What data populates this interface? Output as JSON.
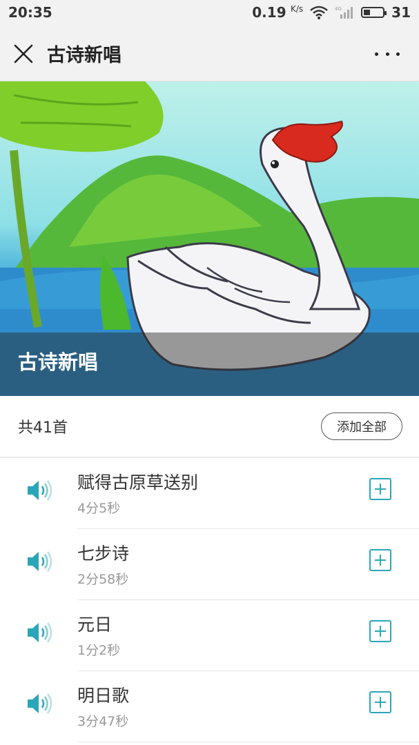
{
  "status_bar": {
    "time": "20:35",
    "net_speed": "0.19",
    "net_unit": "K/s",
    "network_label": "4G",
    "battery": "31"
  },
  "title_bar": {
    "title": "古诗新唱",
    "close_icon": "close-icon",
    "more_icon": "more-icon"
  },
  "banner": {
    "title": "古诗新唱"
  },
  "summary": {
    "count_text": "共41首",
    "add_all_label": "添加全部"
  },
  "colors": {
    "accent": "#2aa6b8",
    "text_primary": "#333333",
    "text_secondary": "#999999"
  },
  "songs": [
    {
      "title": "赋得古原草送别",
      "duration": "4分5秒"
    },
    {
      "title": "七步诗",
      "duration": "2分58秒"
    },
    {
      "title": "元日",
      "duration": "1分2秒"
    },
    {
      "title": "明日歌",
      "duration": "3分47秒"
    }
  ]
}
